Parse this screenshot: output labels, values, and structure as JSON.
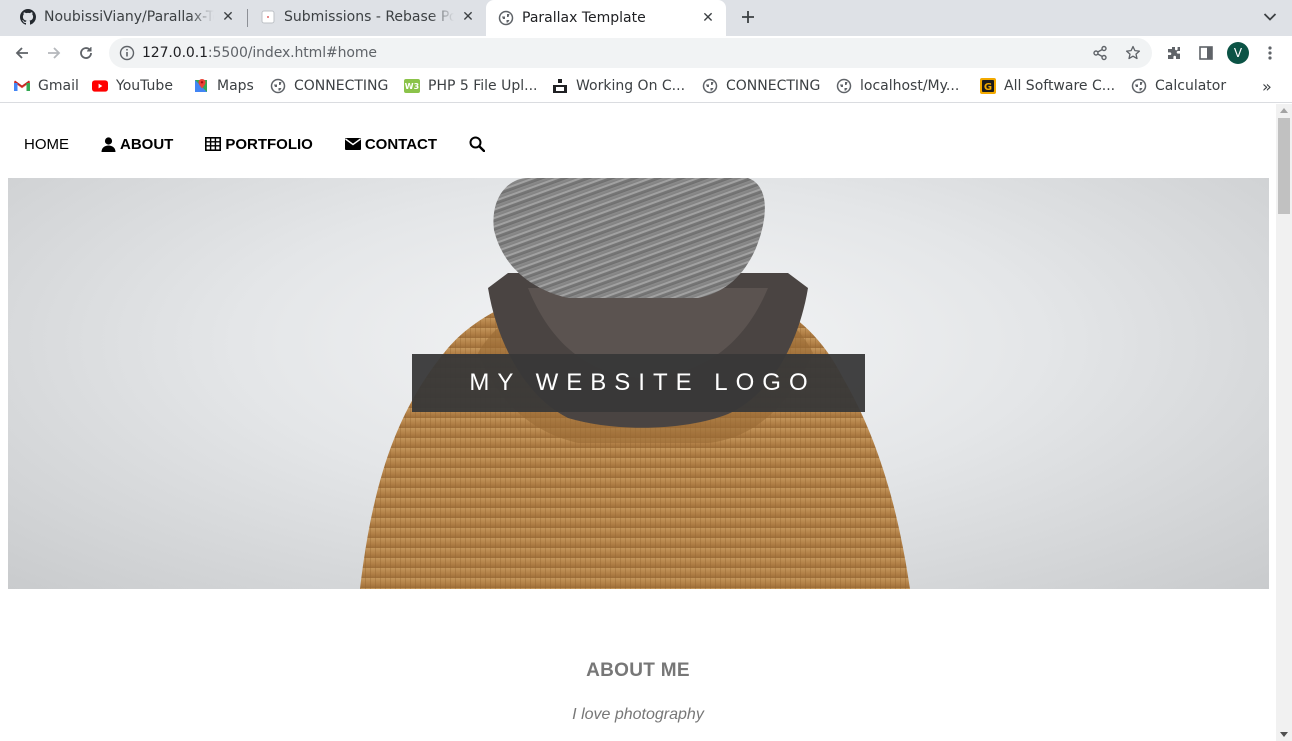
{
  "browser": {
    "tabs": [
      {
        "title": "NoubissiViany/Parallax-Template",
        "icon": "github-icon",
        "active": false
      },
      {
        "title": "Submissions - Rebase Portfolio",
        "icon": "page-icon",
        "active": false
      },
      {
        "title": "Parallax Template",
        "icon": "globe-icon",
        "active": true
      }
    ],
    "url_host": "127.0.0.1",
    "url_rest": ":5500/index.html#home",
    "profile_initial": "V",
    "bookmarks": [
      {
        "label": "Gmail",
        "icon": "gmail-icon"
      },
      {
        "label": "YouTube",
        "icon": "youtube-icon"
      },
      {
        "label": "Maps",
        "icon": "maps-icon"
      },
      {
        "label": "CONNECTING",
        "icon": "globe-icon"
      },
      {
        "label": "PHP 5 File Upl...",
        "icon": "php-icon"
      },
      {
        "label": "Working On C...",
        "icon": "working-icon"
      },
      {
        "label": "CONNECTING",
        "icon": "globe-icon"
      },
      {
        "label": "localhost/My...",
        "icon": "globe-icon"
      },
      {
        "label": "All Software C...",
        "icon": "g-icon"
      },
      {
        "label": "Calculator",
        "icon": "globe-icon"
      }
    ],
    "bookmarks_more": "»"
  },
  "site": {
    "nav": {
      "home": "HOME",
      "about": "ABOUT",
      "portfolio": "PORTFOLIO",
      "contact": "CONTACT"
    },
    "logo_text": "MY WEBSITE LOGO",
    "about_title": "ABOUT ME",
    "about_subtitle": "I love photography"
  },
  "colors": {
    "tabstrip": "#dee1e6",
    "avatar": "#0b5345",
    "logo_box": "#383838",
    "about_text": "#777777"
  }
}
